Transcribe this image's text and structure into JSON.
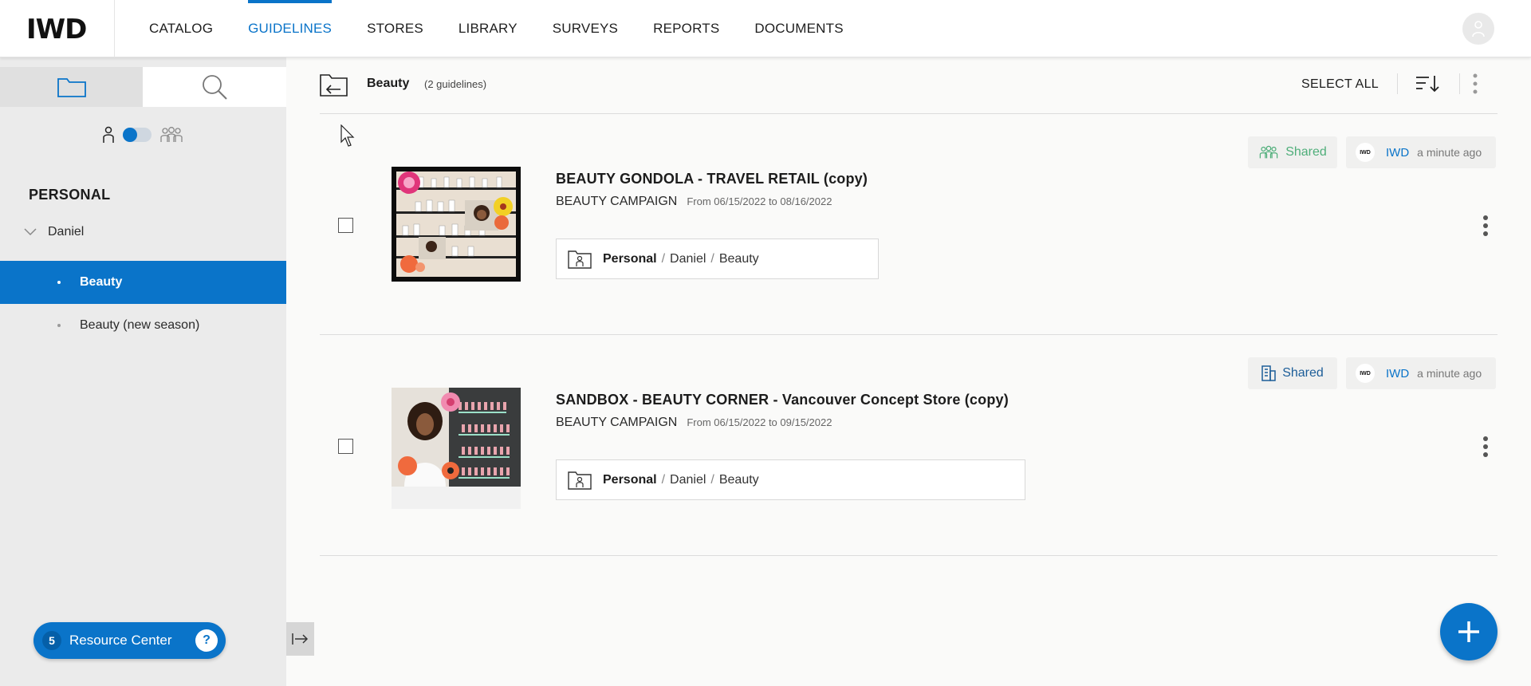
{
  "app": {
    "logo_text": "IWD"
  },
  "nav": {
    "items": [
      {
        "label": "CATALOG",
        "active": false
      },
      {
        "label": "GUIDELINES",
        "active": true
      },
      {
        "label": "STORES",
        "active": false
      },
      {
        "label": "LIBRARY",
        "active": false
      },
      {
        "label": "SURVEYS",
        "active": false
      },
      {
        "label": "REPORTS",
        "active": false
      },
      {
        "label": "DOCUMENTS",
        "active": false
      }
    ],
    "accent_color": "#0a74c9"
  },
  "sidebar": {
    "tabs": [
      "folder-icon",
      "search-icon"
    ],
    "toggle": {
      "left_icon": "person-icon",
      "right_icon": "group-icon",
      "state": "personal"
    },
    "section_title": "PERSONAL",
    "tree": {
      "parent": "Daniel",
      "children": [
        {
          "label": "Beauty",
          "active": true
        },
        {
          "label": "Beauty (new season)",
          "active": false
        }
      ]
    },
    "resource_center": {
      "count": "5",
      "label": "Resource Center"
    }
  },
  "toolbar": {
    "folder_name": "Beauty",
    "count_text": "(2 guidelines)",
    "select_all": "SELECT ALL"
  },
  "guidelines": [
    {
      "title": "BEAUTY GONDOLA - TRAVEL RETAIL (copy)",
      "campaign": "BEAUTY CAMPAIGN",
      "dates": "From 06/15/2022 to 08/16/2022",
      "path": {
        "root": "Personal",
        "sep": "/",
        "mid": "Daniel",
        "leaf": "Beauty"
      },
      "shared_label": "Shared",
      "shared_color": "#4fae7a",
      "author": "IWD",
      "author_logo": "IWD",
      "time": "a minute ago"
    },
    {
      "title": "SANDBOX - BEAUTY CORNER - Vancouver Concept Store (copy)",
      "campaign": "BEAUTY CAMPAIGN",
      "dates": "From 06/15/2022 to 09/15/2022",
      "path": {
        "root": "Personal",
        "sep": "/",
        "mid": "Daniel",
        "leaf": "Beauty"
      },
      "shared_label": "Shared",
      "shared_color": "#1c5d98",
      "author": "IWD",
      "author_logo": "IWD",
      "time": "a minute ago"
    }
  ]
}
